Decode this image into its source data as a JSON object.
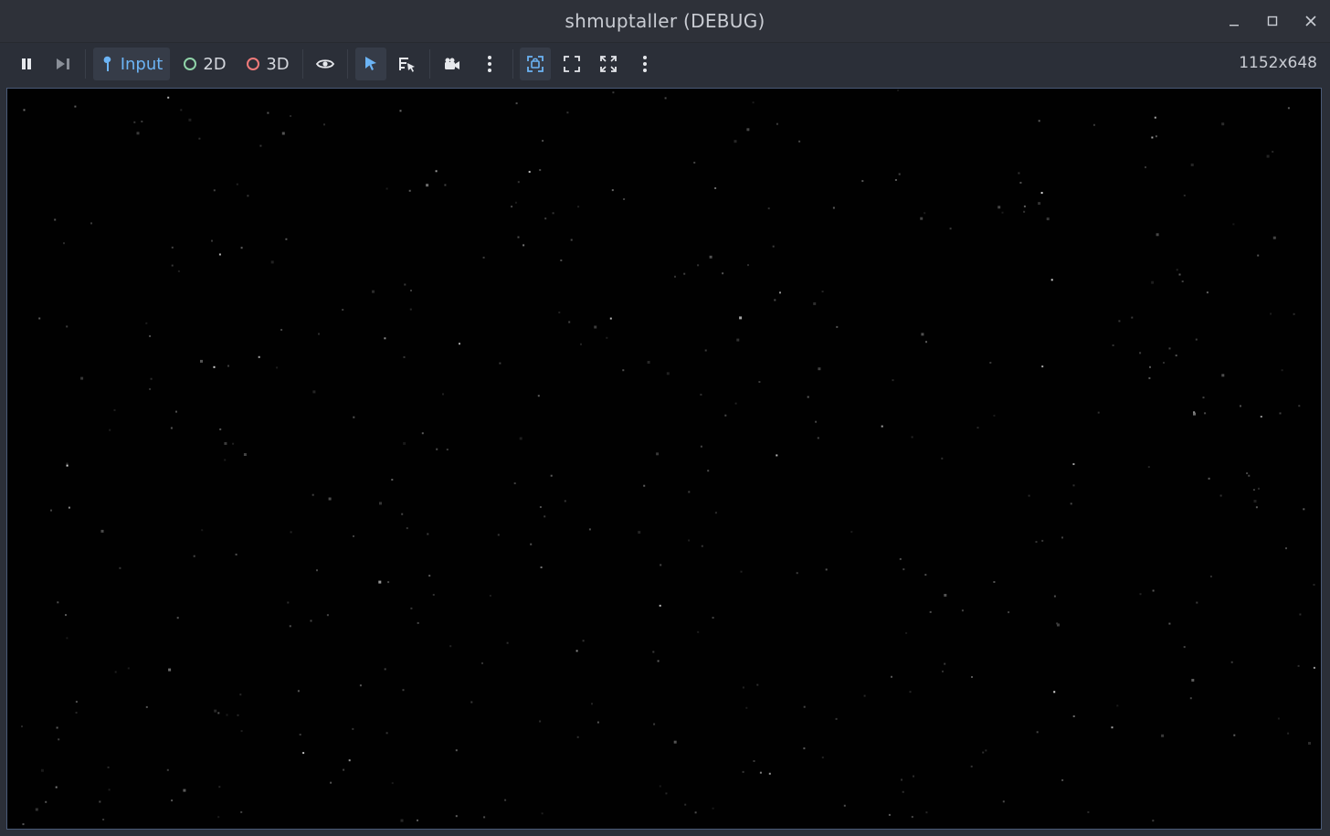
{
  "window": {
    "title": "shmuptaller (DEBUG)",
    "controls": [
      "minimize-icon",
      "maximize-icon",
      "close-icon"
    ]
  },
  "toolbar": {
    "pause_icon": "pause-icon",
    "next_frame_icon": "next-frame-icon",
    "input_label": "Input",
    "mode_2d_label": "2D",
    "mode_3d_label": "3D",
    "visibility_icon": "eye-icon",
    "select_icon": "select-cursor-icon",
    "list_select_icon": "list-select-icon",
    "camera_icon": "camera-override-icon",
    "more_icon": "vertical-dots-icon",
    "fit_icon": "fit-viewport-icon",
    "expand_icon": "expand-icon",
    "fullscreen_icon": "fullscreen-icon",
    "resolution": "1152x648",
    "colors": {
      "accent": "#6cb4f5",
      "mode_2d_ring": "#8fd3a8",
      "mode_3d_ring": "#f07a7a"
    }
  },
  "viewport": {
    "background": "#010101",
    "content": "starfield"
  }
}
